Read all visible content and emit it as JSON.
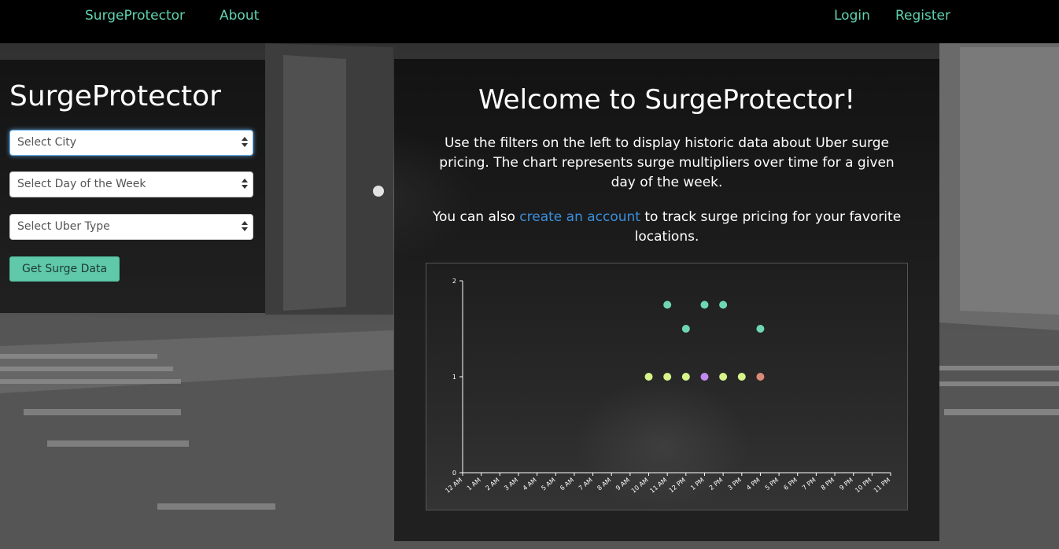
{
  "navbar": {
    "brand": "SurgeProtector",
    "about": "About",
    "login": "Login",
    "register": "Register"
  },
  "sidebar": {
    "title": "SurgeProtector",
    "city_select": "Select City",
    "day_select": "Select Day of the Week",
    "type_select": "Select Uber Type",
    "submit": "Get Surge Data"
  },
  "main": {
    "title": "Welcome to SurgeProtector!",
    "intro": "Use the filters on the left to display historic data about Uber surge pricing. The chart represents surge multipliers over time for a given day of the week.",
    "intro2_before": "You can also ",
    "intro2_link": "create an account",
    "intro2_after": " to track surge pricing for your favorite locations."
  },
  "colors": {
    "accent": "#5fd3b0",
    "button": "#5fc9a9",
    "link": "#3a8fdc",
    "dot_teal": "#6fd6b4",
    "dot_yellowgreen": "#d6f48a",
    "dot_purple": "#c28af0",
    "dot_salmon": "#d98a78"
  },
  "chart_data": {
    "type": "scatter",
    "categories": [
      "12 AM",
      "1 AM",
      "2 AM",
      "3 AM",
      "4 AM",
      "5 AM",
      "6 AM",
      "7 AM",
      "8 AM",
      "9 AM",
      "10 AM",
      "11 AM",
      "12 PM",
      "1 PM",
      "2 PM",
      "3 PM",
      "4 PM",
      "5 PM",
      "6 PM",
      "7 PM",
      "8 PM",
      "9 PM",
      "10 PM",
      "11 PM"
    ],
    "yticks": [
      "0",
      "1",
      "2"
    ],
    "ylim": [
      0,
      2
    ],
    "points": [
      {
        "x": "10 AM",
        "y": 1,
        "color": "#d6f48a"
      },
      {
        "x": "11 AM",
        "y": 1,
        "color": "#d6f48a"
      },
      {
        "x": "11 AM",
        "y": 1.75,
        "color": "#6fd6b4"
      },
      {
        "x": "12 PM",
        "y": 1,
        "color": "#d6f48a"
      },
      {
        "x": "12 PM",
        "y": 1.5,
        "color": "#6fd6b4"
      },
      {
        "x": "1 PM",
        "y": 1,
        "color": "#c28af0"
      },
      {
        "x": "1 PM",
        "y": 1.75,
        "color": "#6fd6b4"
      },
      {
        "x": "2 PM",
        "y": 1,
        "color": "#d6f48a"
      },
      {
        "x": "2 PM",
        "y": 1.75,
        "color": "#6fd6b4"
      },
      {
        "x": "3 PM",
        "y": 1,
        "color": "#d6f48a"
      },
      {
        "x": "4 PM",
        "y": 1,
        "color": "#d98a78"
      },
      {
        "x": "4 PM",
        "y": 1.5,
        "color": "#6fd6b4"
      }
    ],
    "grid": false
  }
}
